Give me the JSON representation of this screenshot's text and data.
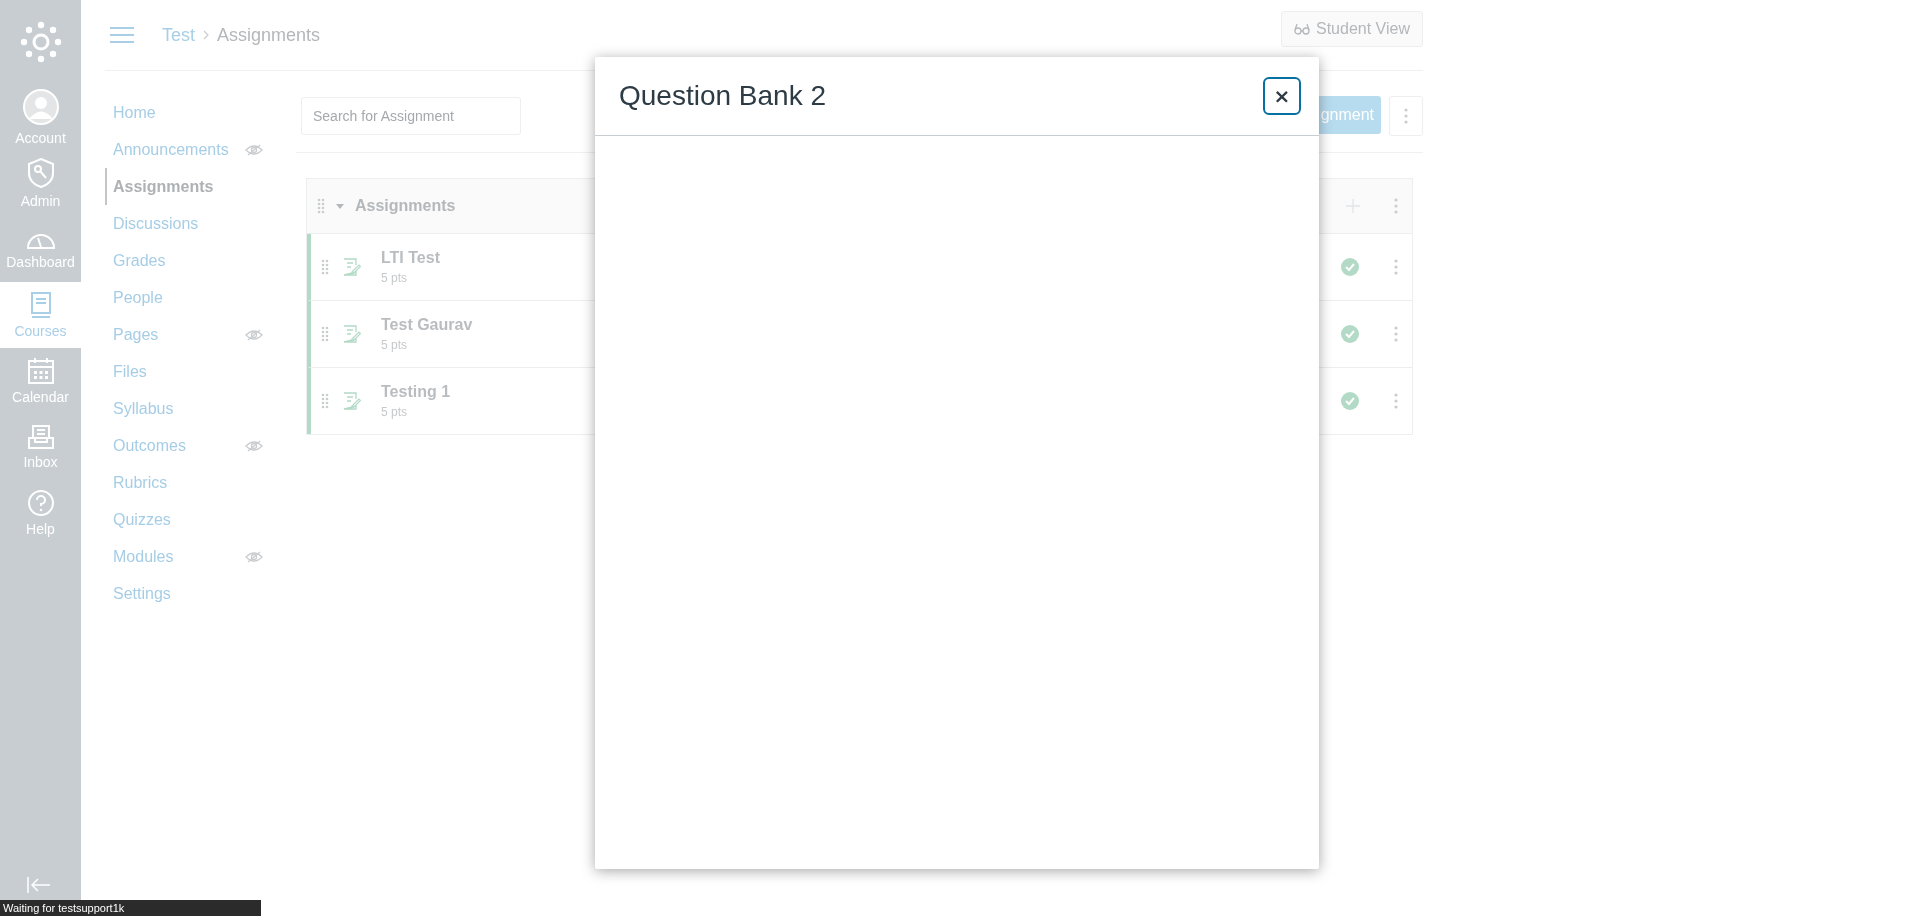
{
  "global_nav": {
    "items": [
      {
        "label": "Account",
        "kind": "account",
        "selected": false
      },
      {
        "label": "Admin",
        "kind": "admin",
        "selected": false
      },
      {
        "label": "Dashboard",
        "kind": "dashboard",
        "selected": false
      },
      {
        "label": "Courses",
        "kind": "courses",
        "selected": true
      },
      {
        "label": "Calendar",
        "kind": "calendar",
        "selected": false
      },
      {
        "label": "Inbox",
        "kind": "inbox",
        "selected": false
      },
      {
        "label": "Help",
        "kind": "help",
        "selected": false
      }
    ]
  },
  "breadcrumb": [
    "Test",
    "Assignments"
  ],
  "student_view_button": "Student View",
  "course_nav": [
    {
      "label": "Home",
      "selected": false,
      "hidden": false
    },
    {
      "label": "Announcements",
      "selected": false,
      "hidden": true
    },
    {
      "label": "Assignments",
      "selected": true,
      "hidden": false
    },
    {
      "label": "Discussions",
      "selected": false,
      "hidden": false
    },
    {
      "label": "Grades",
      "selected": false,
      "hidden": false
    },
    {
      "label": "People",
      "selected": false,
      "hidden": false
    },
    {
      "label": "Pages",
      "selected": false,
      "hidden": true
    },
    {
      "label": "Files",
      "selected": false,
      "hidden": false
    },
    {
      "label": "Syllabus",
      "selected": false,
      "hidden": false
    },
    {
      "label": "Outcomes",
      "selected": false,
      "hidden": true
    },
    {
      "label": "Rubrics",
      "selected": false,
      "hidden": false
    },
    {
      "label": "Quizzes",
      "selected": false,
      "hidden": false
    },
    {
      "label": "Modules",
      "selected": false,
      "hidden": true
    },
    {
      "label": "Settings",
      "selected": false,
      "hidden": false
    }
  ],
  "search": {
    "placeholder": "Search for Assignment"
  },
  "add_button": "gnment",
  "assignment_group": {
    "title": "Assignments",
    "expanded": true,
    "items": [
      {
        "title": "LTI Test",
        "points": "5 pts",
        "published": true
      },
      {
        "title": "Test Gaurav",
        "points": "5 pts",
        "published": true
      },
      {
        "title": "Testing 1",
        "points": "5 pts",
        "published": true
      }
    ]
  },
  "modal": {
    "title": "Question Bank 2",
    "close_label": "×"
  },
  "status_bar": "Waiting for testsupport1k"
}
